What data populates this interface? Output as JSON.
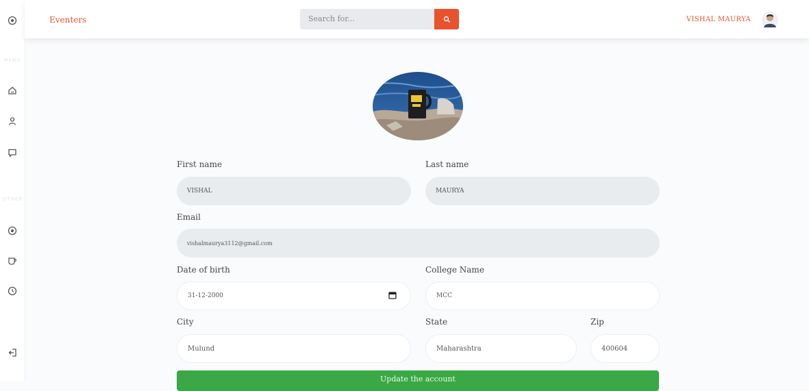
{
  "header": {
    "brand": "Eventers",
    "search_placeholder": "Search for...",
    "user_name": "VISHAL MAURYA"
  },
  "sidebar": {
    "section_1": "MENU",
    "section_2": "OTHER"
  },
  "form": {
    "first_name_label": "First name",
    "first_name_value": "VISHAL",
    "last_name_label": "Last name",
    "last_name_value": "MAURYA",
    "email_label": "Email",
    "email_value": "vishalmaurya3112@gmail.com",
    "dob_label": "Date of birth",
    "dob_value": "31-12-2000",
    "college_label": "College Name",
    "college_value": "MCC",
    "city_label": "City",
    "city_value": "Mulund",
    "state_label": "State",
    "state_value": "Maharashtra",
    "zip_label": "Zip",
    "zip_value": "400604",
    "submit_label": "Update the account"
  },
  "colors": {
    "accent": "#e8532e",
    "submit": "#3aa845",
    "field_fill": "#e9ecef"
  }
}
